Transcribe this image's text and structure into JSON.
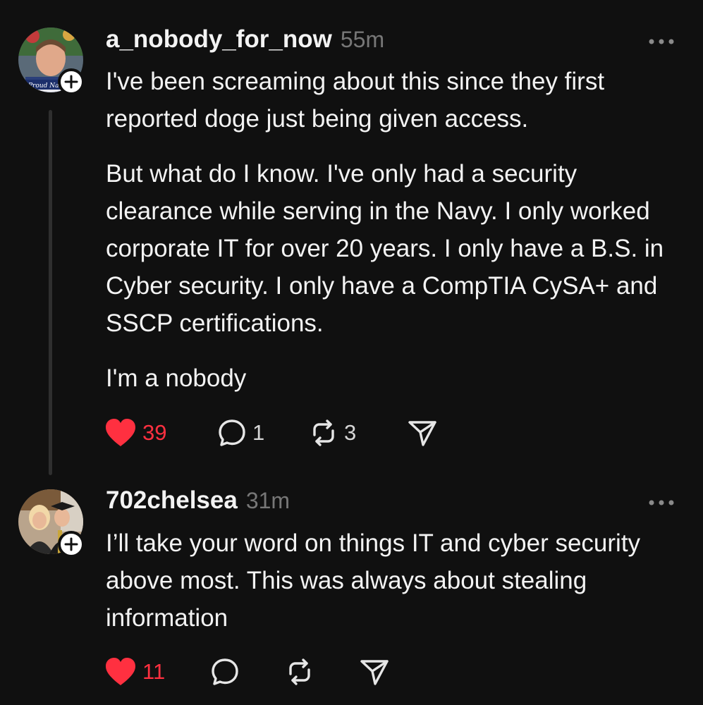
{
  "posts": [
    {
      "username": "a_nobody_for_now",
      "time": "55m",
      "paragraphs": [
        "I've been screaming about this since they first reported doge just being given access.",
        "But what do I know. I've only had a security clearance while serving in the Navy. I only worked corporate IT for over 20 years. I only have a B.S. in Cyber security. I only have a CompTIA CySA+ and SSCP certifications.",
        "I'm a nobody"
      ],
      "likes": "39",
      "replies": "1",
      "reposts": "3",
      "avatar_text": "Proud Nav"
    },
    {
      "username": "702chelsea",
      "time": "31m",
      "paragraphs": [
        "I’ll take your word on things IT and cyber security above most. This was always about stealing information"
      ],
      "likes": "11"
    }
  ],
  "icons": {
    "like": "heart-filled-icon",
    "reply": "speech-bubble-icon",
    "repost": "repost-arrows-icon",
    "share": "paper-plane-icon",
    "more": "ellipsis-icon",
    "follow": "plus-icon"
  },
  "colors": {
    "background": "#101010",
    "like": "#ff3040",
    "text": "#f3f3f3",
    "muted": "#777777"
  }
}
